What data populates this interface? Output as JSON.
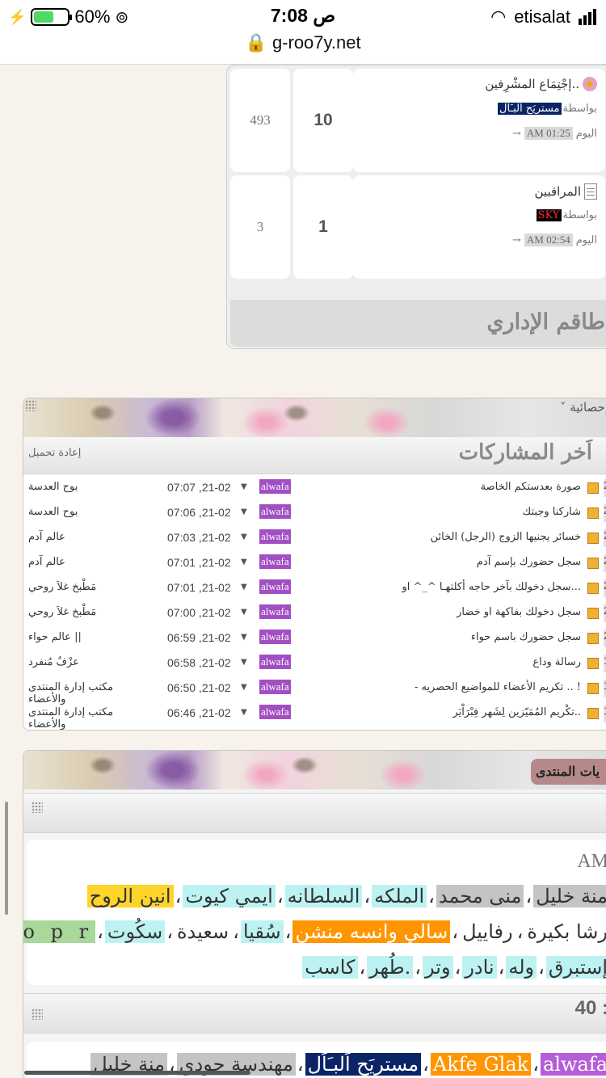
{
  "status_bar": {
    "battery": "60%",
    "time": "7:08 ص",
    "carrier": "etisalat",
    "url": "g-roo7y.net"
  },
  "top_table": {
    "rows": [
      {
        "num": "493",
        "count": "10",
        "title": "إجْتِمَاع المشْرِفين..",
        "by_label": "بواسطة",
        "user": "مستريَح اَلبـَاَل",
        "day": "اليوم",
        "time": "AM 01:25"
      },
      {
        "num": "3",
        "count": "1",
        "title": "المراقبين",
        "by_label": "بواسطة",
        "user": "SKY",
        "day": "اليوم",
        "time": "AM 02:54"
      }
    ],
    "footer": "طاقم الإداري"
  },
  "latest_posts": {
    "section_label": "إحصائية",
    "title": "اَخر المشاركات",
    "reload": "إعادة تحميل",
    "rows": [
      {
        "day": "21",
        "topic": "صورة بعدستكم الخاصة",
        "user": "alwafa",
        "time": "07:07 ,21-02",
        "section": "بوح العدسة"
      },
      {
        "day": "21",
        "topic": "شاركنا وجبتك",
        "user": "alwafa",
        "time": "07:06 ,21-02",
        "section": "بوح العدسة"
      },
      {
        "day": "21",
        "topic": "خسائر يجنيها الزوج (الرجل) الخائن",
        "user": "alwafa",
        "time": "07:03 ,21-02",
        "section": "عالم آدم"
      },
      {
        "day": "20",
        "topic": "سجل حضورك بإسم آدم",
        "user": "alwafa",
        "time": "07:01 ,21-02",
        "section": "عالم آدم"
      },
      {
        "day": "20",
        "topic": "سجل دخولك بآخر حاجه أكلتهـا ^_^ او...",
        "user": "alwafa",
        "time": "07:01 ,21-02",
        "section": "مَطْبخ غلاَ روحي"
      },
      {
        "day": "20",
        "topic": "سجل دخولك بفاكهة او خضار",
        "user": "alwafa",
        "time": "07:00 ,21-02",
        "section": "مَطْبخ غلاَ روحي"
      },
      {
        "day": "20",
        "topic": "سجل حضورك باسم حواء",
        "user": "alwafa",
        "time": "06:59 ,21-02",
        "section": "|| عالم حواء"
      },
      {
        "day": "19",
        "topic": "رسالة وداع",
        "user": "alwafa",
        "time": "06:58 ,21-02",
        "section": "عزْفٌ مُنفرد"
      },
      {
        "day": "19",
        "topic": "- تكريم الأعضاء للمواضيع الحصريه .. !",
        "user": "alwafa",
        "time": "06:50 ,21-02",
        "section": "مكتب إدارة المنتدى والأعضاء"
      },
      {
        "day": "18",
        "topic": "تكْريم المُمَيّزين لِشَهر فِبْرَاْيَر..",
        "user": "alwafa",
        "time": "06:46 ,21-02",
        "section": "مكتب إدارة المنتدى والأعضاء"
      }
    ]
  },
  "forum_stats": {
    "tab_label": "يات المنتدى",
    "am_text": "AM.",
    "line1": [
      {
        "name": "منة خليل",
        "color": "gray"
      },
      {
        "name": "منى محمد",
        "color": "gray"
      },
      {
        "name": "الملكه",
        "color": "cyan"
      },
      {
        "name": "السلطانه",
        "color": "cyan"
      },
      {
        "name": "ايمي كيوت",
        "color": "cyan"
      },
      {
        "name": "انين الروح",
        "color": "yellow"
      }
    ],
    "line2": [
      {
        "name": "رشا بكيرة",
        "color": "none"
      },
      {
        "name": "رفاييل",
        "color": "none"
      },
      {
        "name": "سالي وانسه منشن",
        "color": "orange"
      },
      {
        "name": "سُقيا",
        "color": "cyan"
      },
      {
        "name": "سعيدة",
        "color": "none"
      },
      {
        "name": "سكُوت",
        "color": "cyan"
      },
      {
        "name": "S o p r",
        "color": "green"
      }
    ],
    "line3": [
      {
        "name": "إستبرق",
        "color": "cyan"
      },
      {
        "name": "وله",
        "color": "cyan"
      },
      {
        "name": "نادر",
        "color": "cyan"
      },
      {
        "name": "وتر",
        "color": "cyan"
      },
      {
        "name": "طُهر.",
        "color": "cyan"
      },
      {
        "name": "كاسب",
        "color": "cyan"
      }
    ],
    "count_text": "40 :",
    "bottom_line": [
      {
        "name": "alwafa",
        "color": "purple"
      },
      {
        "name": "Akfe Glak",
        "color": "orange"
      },
      {
        "name": "مستريَح اَلبـَاَل",
        "color": "navy"
      },
      {
        "name": "مهندسة حودي",
        "color": "gray"
      },
      {
        "name": "منة خليل",
        "color": "gray"
      }
    ]
  }
}
